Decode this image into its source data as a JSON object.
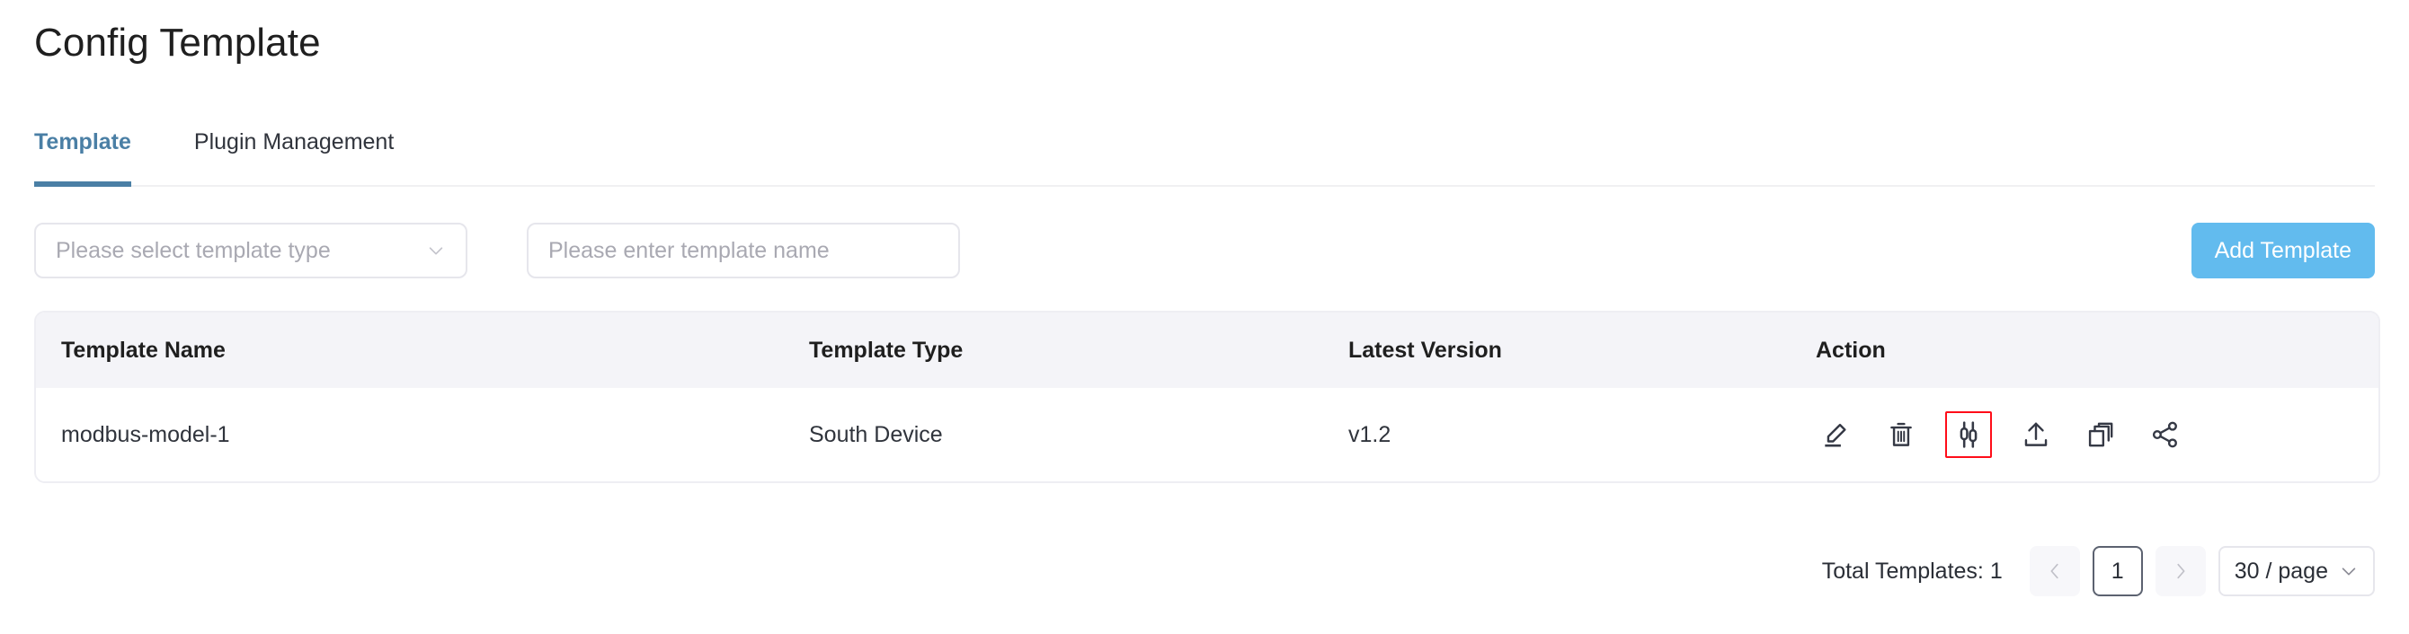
{
  "header": {
    "title": "Config Template"
  },
  "tabs": [
    {
      "label": "Template",
      "active": true
    },
    {
      "label": "Plugin Management",
      "active": false
    }
  ],
  "filters": {
    "type_select": {
      "placeholder": "Please select template type",
      "value": "",
      "icon": "chevron-down-icon"
    },
    "name_input": {
      "placeholder": "Please enter template name",
      "value": ""
    },
    "add_button": {
      "label": "Add Template",
      "color": "#62bbee"
    }
  },
  "table": {
    "columns": [
      "Template Name",
      "Template Type",
      "Latest Version",
      "Action"
    ],
    "rows": [
      {
        "name": "modbus-model-1",
        "type": "South Device",
        "version": "v1.2",
        "actions": [
          {
            "icon": "edit-pencil-icon",
            "highlighted": false
          },
          {
            "icon": "delete-trash-icon",
            "highlighted": false
          },
          {
            "icon": "settings-sliders-icon",
            "highlighted": true
          },
          {
            "icon": "upload-icon",
            "highlighted": false
          },
          {
            "icon": "copy-icon",
            "highlighted": false
          },
          {
            "icon": "share-icon",
            "highlighted": false
          }
        ]
      }
    ],
    "highlight_color": "#ff0d19"
  },
  "pagination": {
    "total_label": "Total Templates: 1",
    "prev_icon": "chevron-left-icon",
    "next_icon": "chevron-right-icon",
    "current_page": "1",
    "page_size": "30 / page",
    "page_size_icon": "chevron-down-icon"
  }
}
